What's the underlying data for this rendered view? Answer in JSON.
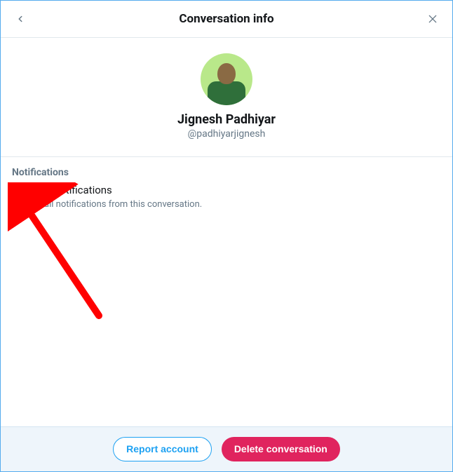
{
  "header": {
    "title": "Conversation info"
  },
  "profile": {
    "display_name": "Jignesh Padhiyar",
    "handle": "@padhiyarjignesh"
  },
  "notifications": {
    "heading": "Notifications",
    "mute_label": "Mute notifications",
    "description": "Disable all notifications from this conversation."
  },
  "footer": {
    "report_label": "Report account",
    "delete_label": "Delete conversation"
  },
  "annotation": {
    "arrow_color": "#ff0000"
  }
}
